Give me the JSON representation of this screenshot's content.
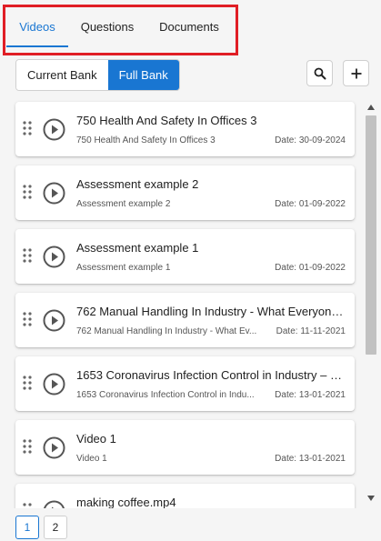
{
  "tabs": [
    {
      "label": "Videos",
      "active": true
    },
    {
      "label": "Questions",
      "active": false
    },
    {
      "label": "Documents",
      "active": false
    }
  ],
  "bank_toggle": {
    "current_label": "Current Bank",
    "full_label": "Full Bank",
    "selected": "Full Bank"
  },
  "toolbar": {
    "search_icon": "search-icon",
    "add_icon": "plus-icon"
  },
  "items": [
    {
      "title": "750 Health And Safety In Offices 3",
      "subtitle": "750 Health And Safety In Offices 3",
      "date": "Date: 30-09-2024"
    },
    {
      "title": "Assessment example 2",
      "subtitle": "Assessment example 2",
      "date": "Date: 01-09-2022"
    },
    {
      "title": "Assessment example 1",
      "subtitle": "Assessment example 1",
      "date": "Date: 01-09-2022"
    },
    {
      "title": "762 Manual Handling In Industry - What Everyone ...",
      "subtitle": "762 Manual Handling In Industry - What Ev...",
      "date": "Date: 11-11-2021"
    },
    {
      "title": "1653 Coronavirus Infection Control in Industry – W...",
      "subtitle": "1653 Coronavirus Infection Control in Indu...",
      "date": "Date: 13-01-2021"
    },
    {
      "title": "Video 1",
      "subtitle": "Video 1",
      "date": "Date: 13-01-2021"
    },
    {
      "title": "making coffee.mp4",
      "subtitle": "",
      "date": ""
    }
  ],
  "pagination": {
    "pages": [
      "1",
      "2"
    ],
    "current": "1"
  },
  "colors": {
    "accent": "#1976d2",
    "highlight": "#e01e25",
    "background": "#f5f5f5"
  }
}
